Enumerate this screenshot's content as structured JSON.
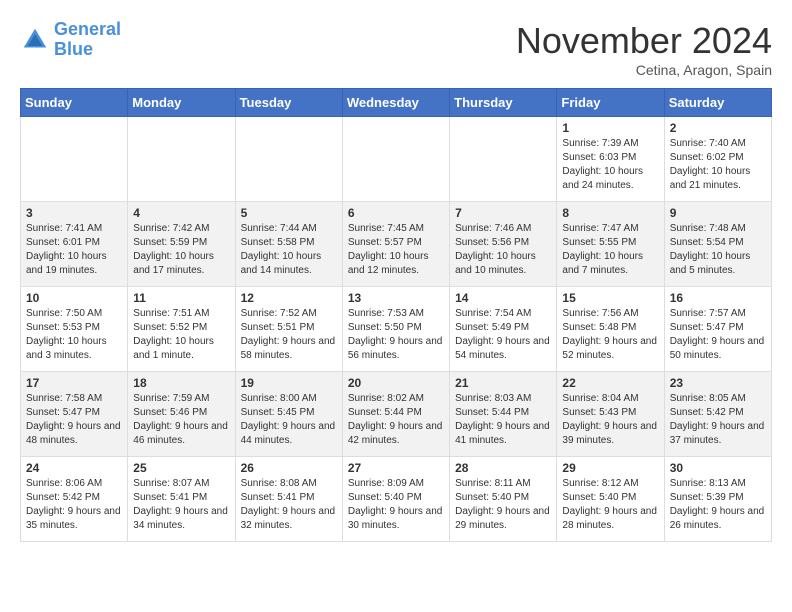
{
  "header": {
    "logo_line1": "General",
    "logo_line2": "Blue",
    "month": "November 2024",
    "location": "Cetina, Aragon, Spain"
  },
  "weekdays": [
    "Sunday",
    "Monday",
    "Tuesday",
    "Wednesday",
    "Thursday",
    "Friday",
    "Saturday"
  ],
  "weeks": [
    [
      {
        "day": "",
        "text": ""
      },
      {
        "day": "",
        "text": ""
      },
      {
        "day": "",
        "text": ""
      },
      {
        "day": "",
        "text": ""
      },
      {
        "day": "",
        "text": ""
      },
      {
        "day": "1",
        "text": "Sunrise: 7:39 AM\nSunset: 6:03 PM\nDaylight: 10 hours and 24 minutes."
      },
      {
        "day": "2",
        "text": "Sunrise: 7:40 AM\nSunset: 6:02 PM\nDaylight: 10 hours and 21 minutes."
      }
    ],
    [
      {
        "day": "3",
        "text": "Sunrise: 7:41 AM\nSunset: 6:01 PM\nDaylight: 10 hours and 19 minutes."
      },
      {
        "day": "4",
        "text": "Sunrise: 7:42 AM\nSunset: 5:59 PM\nDaylight: 10 hours and 17 minutes."
      },
      {
        "day": "5",
        "text": "Sunrise: 7:44 AM\nSunset: 5:58 PM\nDaylight: 10 hours and 14 minutes."
      },
      {
        "day": "6",
        "text": "Sunrise: 7:45 AM\nSunset: 5:57 PM\nDaylight: 10 hours and 12 minutes."
      },
      {
        "day": "7",
        "text": "Sunrise: 7:46 AM\nSunset: 5:56 PM\nDaylight: 10 hours and 10 minutes."
      },
      {
        "day": "8",
        "text": "Sunrise: 7:47 AM\nSunset: 5:55 PM\nDaylight: 10 hours and 7 minutes."
      },
      {
        "day": "9",
        "text": "Sunrise: 7:48 AM\nSunset: 5:54 PM\nDaylight: 10 hours and 5 minutes."
      }
    ],
    [
      {
        "day": "10",
        "text": "Sunrise: 7:50 AM\nSunset: 5:53 PM\nDaylight: 10 hours and 3 minutes."
      },
      {
        "day": "11",
        "text": "Sunrise: 7:51 AM\nSunset: 5:52 PM\nDaylight: 10 hours and 1 minute."
      },
      {
        "day": "12",
        "text": "Sunrise: 7:52 AM\nSunset: 5:51 PM\nDaylight: 9 hours and 58 minutes."
      },
      {
        "day": "13",
        "text": "Sunrise: 7:53 AM\nSunset: 5:50 PM\nDaylight: 9 hours and 56 minutes."
      },
      {
        "day": "14",
        "text": "Sunrise: 7:54 AM\nSunset: 5:49 PM\nDaylight: 9 hours and 54 minutes."
      },
      {
        "day": "15",
        "text": "Sunrise: 7:56 AM\nSunset: 5:48 PM\nDaylight: 9 hours and 52 minutes."
      },
      {
        "day": "16",
        "text": "Sunrise: 7:57 AM\nSunset: 5:47 PM\nDaylight: 9 hours and 50 minutes."
      }
    ],
    [
      {
        "day": "17",
        "text": "Sunrise: 7:58 AM\nSunset: 5:47 PM\nDaylight: 9 hours and 48 minutes."
      },
      {
        "day": "18",
        "text": "Sunrise: 7:59 AM\nSunset: 5:46 PM\nDaylight: 9 hours and 46 minutes."
      },
      {
        "day": "19",
        "text": "Sunrise: 8:00 AM\nSunset: 5:45 PM\nDaylight: 9 hours and 44 minutes."
      },
      {
        "day": "20",
        "text": "Sunrise: 8:02 AM\nSunset: 5:44 PM\nDaylight: 9 hours and 42 minutes."
      },
      {
        "day": "21",
        "text": "Sunrise: 8:03 AM\nSunset: 5:44 PM\nDaylight: 9 hours and 41 minutes."
      },
      {
        "day": "22",
        "text": "Sunrise: 8:04 AM\nSunset: 5:43 PM\nDaylight: 9 hours and 39 minutes."
      },
      {
        "day": "23",
        "text": "Sunrise: 8:05 AM\nSunset: 5:42 PM\nDaylight: 9 hours and 37 minutes."
      }
    ],
    [
      {
        "day": "24",
        "text": "Sunrise: 8:06 AM\nSunset: 5:42 PM\nDaylight: 9 hours and 35 minutes."
      },
      {
        "day": "25",
        "text": "Sunrise: 8:07 AM\nSunset: 5:41 PM\nDaylight: 9 hours and 34 minutes."
      },
      {
        "day": "26",
        "text": "Sunrise: 8:08 AM\nSunset: 5:41 PM\nDaylight: 9 hours and 32 minutes."
      },
      {
        "day": "27",
        "text": "Sunrise: 8:09 AM\nSunset: 5:40 PM\nDaylight: 9 hours and 30 minutes."
      },
      {
        "day": "28",
        "text": "Sunrise: 8:11 AM\nSunset: 5:40 PM\nDaylight: 9 hours and 29 minutes."
      },
      {
        "day": "29",
        "text": "Sunrise: 8:12 AM\nSunset: 5:40 PM\nDaylight: 9 hours and 28 minutes."
      },
      {
        "day": "30",
        "text": "Sunrise: 8:13 AM\nSunset: 5:39 PM\nDaylight: 9 hours and 26 minutes."
      }
    ]
  ]
}
